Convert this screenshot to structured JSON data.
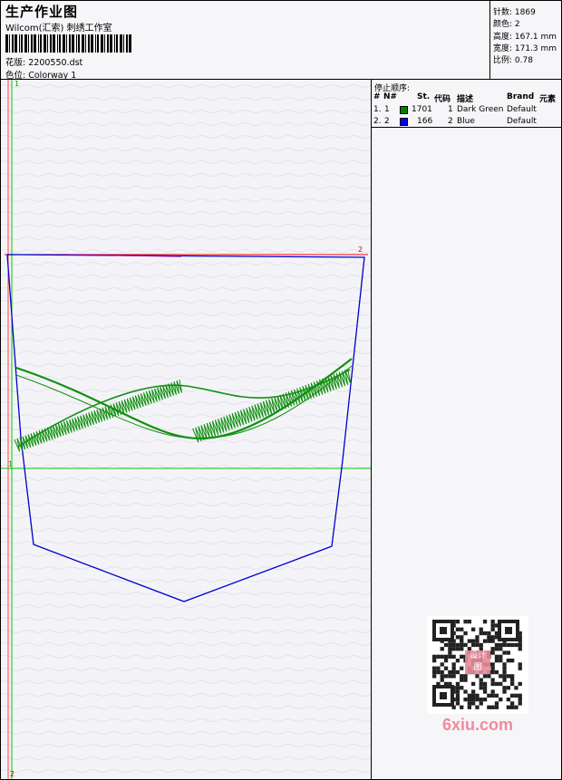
{
  "header": {
    "title": "生产作业图",
    "subtitle": "Wilcom(汇索) 刺绣工作室",
    "design_label": "花版:",
    "design_value": "2200550.dst",
    "color_label": "色位:",
    "color_value": "Colorway 1"
  },
  "stats": {
    "stitches": "针数: 1869",
    "colors": "颜色: 2",
    "height": "高度: 167.1 mm",
    "width": "宽度: 171.3 mm",
    "scale": "比例: 0.78"
  },
  "stop_sequence": {
    "title": "停止顺序:",
    "columns": [
      "#",
      "N#",
      "St.",
      "代码",
      "描述",
      "Brand",
      "元素"
    ],
    "rows": [
      {
        "index": "1.",
        "needle": "1",
        "swatch_color": "#008000",
        "stitches": "1701",
        "code": "1",
        "description": "Dark Green",
        "brand": "Default"
      },
      {
        "index": "2.",
        "needle": "2",
        "swatch_color": "#0000ff",
        "stitches": "166",
        "code": "2",
        "description": "Blue",
        "brand": "Default"
      }
    ]
  },
  "canvas": {
    "marker_top": "1",
    "marker_bottom": "2",
    "marker_red": "2",
    "marker_green": "1",
    "line_colors": {
      "red": "#ff0000",
      "green": "#00cc00",
      "blue": "#0000cc",
      "stitch": "#119011"
    }
  },
  "watermark": {
    "text": "6xiu.com",
    "stamp": "设计 图"
  }
}
